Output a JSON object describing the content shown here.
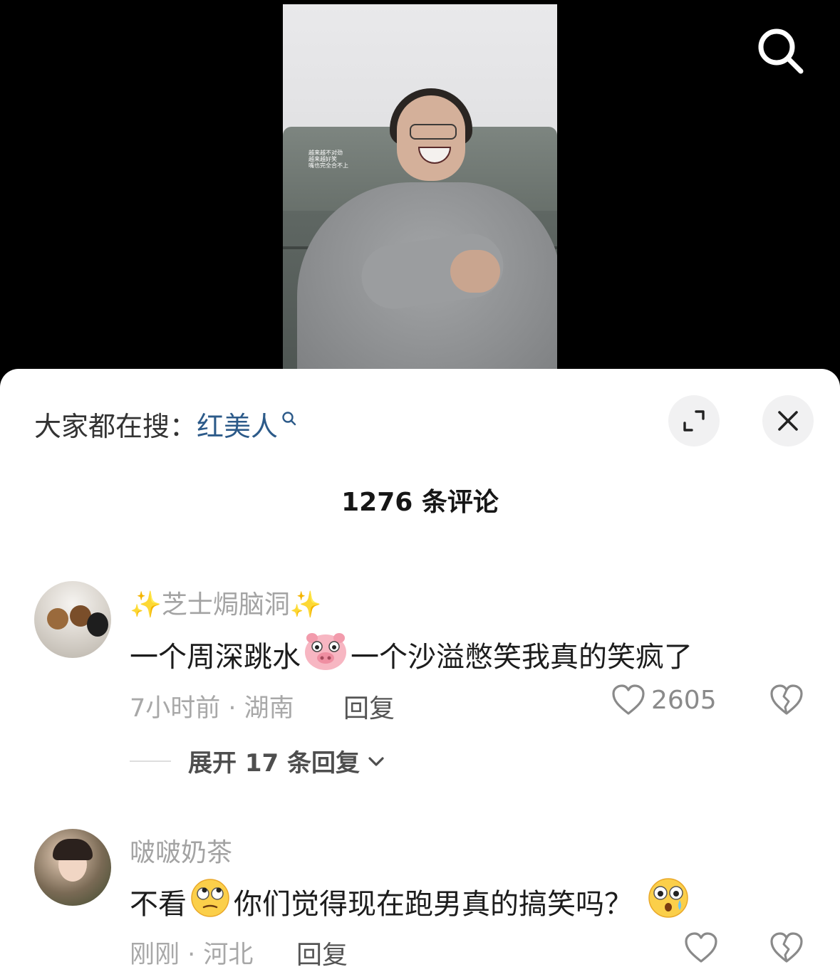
{
  "video": {
    "overlay_lines": [
      "越来越不对劲",
      "越来越好笑",
      "嘴也完全合不上"
    ]
  },
  "header": {
    "search_icon": "search-icon"
  },
  "panel": {
    "hot_search_prefix": "大家都在搜：",
    "hot_search_keyword": "红美人",
    "comment_count": "1276 条评论",
    "expand_icon": "fullscreen-icon",
    "close_icon": "close-icon"
  },
  "comments": [
    {
      "username": "✨芝士焗脑洞✨",
      "text_part1": "一个周深跳水",
      "emoji1": "pig-emoji",
      "text_part2": "一个沙溢憋笑我真的笑疯了",
      "meta": "7小时前 · 湖南",
      "reply_label": "回复",
      "likes": "2605",
      "expand_label": "展开 17 条回复"
    },
    {
      "username": "啵啵奶茶",
      "text_part1": "不看",
      "emoji1": "eye-roll-emoji",
      "text_part2": "你们觉得现在跑男真的搞笑吗？",
      "emoji2": "shocked-emoji",
      "meta": "刚刚 · 河北",
      "reply_label": "回复"
    }
  ],
  "colors": {
    "keyword": "#2c5a89",
    "meta": "#a8a8a8",
    "background": "#000000"
  }
}
